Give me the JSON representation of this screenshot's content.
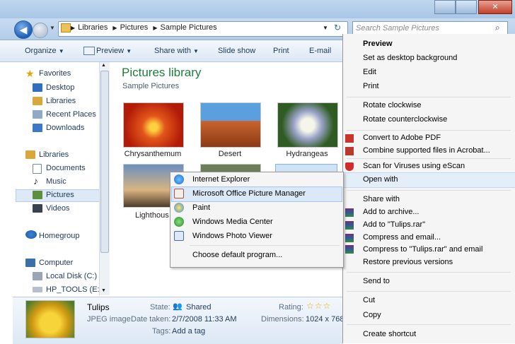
{
  "address": {
    "crumbs": [
      "Libraries",
      "Pictures",
      "Sample Pictures"
    ],
    "search_placeholder": "Search Sample Pictures"
  },
  "toolbar": {
    "organize": "Organize",
    "preview": "Preview",
    "share_with": "Share with",
    "slide_show": "Slide show",
    "print": "Print",
    "email": "E-mail"
  },
  "nav": {
    "favorites": "Favorites",
    "desktop": "Desktop",
    "libraries_fav": "Libraries",
    "recent": "Recent Places",
    "downloads": "Downloads",
    "libraries": "Libraries",
    "documents": "Documents",
    "music": "Music",
    "pictures": "Pictures",
    "videos": "Videos",
    "homegroup": "Homegroup",
    "computer": "Computer",
    "local_disk": "Local Disk (C:)",
    "hp_tools": "HP_TOOLS (E:)"
  },
  "library": {
    "title": "Pictures library",
    "subtitle": "Sample Pictures",
    "items": [
      "Chrysanthemum",
      "Desert",
      "Hydrangeas",
      "Lighthous"
    ]
  },
  "details": {
    "name": "Tulips",
    "type": "JPEG image",
    "state_label": "State:",
    "state_value": "Shared",
    "date_label": "Date taken:",
    "date_value": "2/7/2008 11:33 AM",
    "tags_label": "Tags:",
    "tags_value": "Add a tag",
    "rating_label": "Rating:",
    "dimensions_label": "Dimensions:",
    "dimensions_value": "1024 x 768"
  },
  "context_menu": {
    "preview": "Preview",
    "set_desktop": "Set as desktop background",
    "edit": "Edit",
    "print": "Print",
    "rotate_cw": "Rotate clockwise",
    "rotate_ccw": "Rotate counterclockwise",
    "convert_pdf": "Convert to Adobe PDF",
    "combine_acrobat": "Combine supported files in Acrobat...",
    "scan": "Scan for Viruses using eScan",
    "open_with": "Open with",
    "share_with": "Share with",
    "add_archive": "Add to archive...",
    "add_rar": "Add to \"Tulips.rar\"",
    "compress_email": "Compress and email...",
    "compress_rar_email": "Compress to \"Tulips.rar\" and email",
    "restore": "Restore previous versions",
    "send_to": "Send to",
    "cut": "Cut",
    "copy": "Copy",
    "create_shortcut": "Create shortcut"
  },
  "open_with_menu": {
    "ie": "Internet Explorer",
    "picture_manager": "Microsoft Office Picture Manager",
    "paint": "Paint",
    "media_center": "Windows Media Center",
    "photo_viewer": "Windows Photo Viewer",
    "choose_default": "Choose default program..."
  },
  "colors": {
    "library_title": "#1e7e3a",
    "nav_text": "#1e395b",
    "hover": "#dbe8f8"
  }
}
